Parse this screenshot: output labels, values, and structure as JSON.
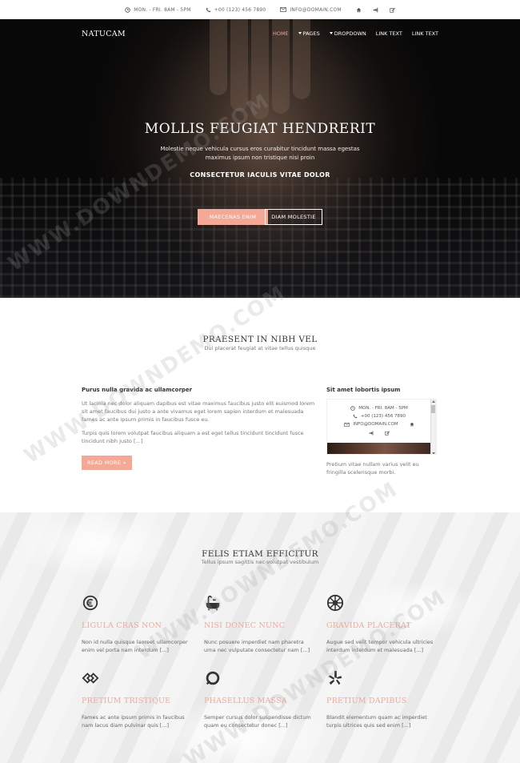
{
  "topbar": {
    "hours": "MON. - FRI. 8AM - 5PM",
    "phone": "+00 (123) 456 7890",
    "email": "INFO@DOMAIN.COM"
  },
  "nav": {
    "brand": "NATUCAM",
    "items": [
      {
        "label": "HOME",
        "active": true,
        "dropdown": false
      },
      {
        "label": "PAGES",
        "active": false,
        "dropdown": true
      },
      {
        "label": "DROPDOWN",
        "active": false,
        "dropdown": true
      },
      {
        "label": "LINK TEXT",
        "active": false,
        "dropdown": false
      },
      {
        "label": "LINK TEXT",
        "active": false,
        "dropdown": false
      }
    ]
  },
  "hero": {
    "title": "MOLLIS FEUGIAT HENDRERIT",
    "text_line1": "Molestie neque vehicula cursus eros curabitur tincidunt massa egestas",
    "text_line2": "maximus ipsum non tristique nisi proin",
    "subtitle": "CONSECTETUR IACULIS VITAE DOLOR",
    "button_primary": "MAECENAS ENIM",
    "button_secondary": "DIAM MOLESTIE"
  },
  "intro": {
    "title": "PRAESENT IN NIBH VEL",
    "subtitle": "Dui placerat feugiat at vitae tellus quisque",
    "left_heading": "Purus nulla gravida ac ullamcorper",
    "left_para1": "Ut lacinia nec dolor aliquam dapibus est vitae maximus faucibus justo elit euismod lorem sit amet faucibus dui justo a ante vivamus eget lorem sapien interdum et malesuada fames ac ante ipsum primis in faucibus fusce eu.",
    "left_para2": "Turpis quis lorem volutpat faucibus aliquam a est eget tellus tincidunt tincidunt fusce tincidunt nibh justo [...]",
    "read_more": "READ MORE »",
    "right_heading": "Sit amet lobortis ipsum",
    "right_text": "Pretium vitae nullam varius velit eu fringilla scelerisque morbi.",
    "widget": {
      "hours": "MON. - FRI. 8AM - 5PM",
      "phone": "+00 (123) 456 7890",
      "email": "INFO@DOMAIN.COM"
    }
  },
  "features": {
    "title": "FELIS ETIAM EFFICITUR",
    "subtitle": "Tellus ipsum sagittis nec volutpat vestibulum",
    "items": [
      {
        "icon": "euro-icon",
        "title": "LIGULA CRAS NON",
        "text": "Non id nulla quisque laoreet ullamcorper enim vel porta nam interdum [...]"
      },
      {
        "icon": "bathtub-icon",
        "title": "NISI DONEC NUNC",
        "text": "Nunc posuere imperdiet nam pharetra urna nec vulputate consectetur nam [...]"
      },
      {
        "icon": "empire-icon",
        "title": "GRAVIDA PLACERAT",
        "text": "Augue sed velit tempor vehicula ultricies interdum interdum et malesuada [...]"
      },
      {
        "icon": "diamond-link-icon",
        "title": "PRETIUM TRISTIQUE",
        "text": "Fames ac ante ipsum primis in faucibus nam lacus diam pulvinar quis [...]"
      },
      {
        "icon": "ring-icon",
        "title": "PHASELLUS MASSA",
        "text": "Semper cursus dolor suspendisse dictum quam eu consectetur donec [...]"
      },
      {
        "icon": "yelp-icon",
        "title": "PRETIUM DAPIBUS",
        "text": "Blandit elementum quam ac imperdiet turpis ultrices quis sed enim [...]"
      }
    ]
  },
  "watermark": "WWW.DOWNDEMO.COM",
  "colors": {
    "accent": "#f3a996",
    "dark_text": "#333333",
    "muted_text": "#777777"
  }
}
